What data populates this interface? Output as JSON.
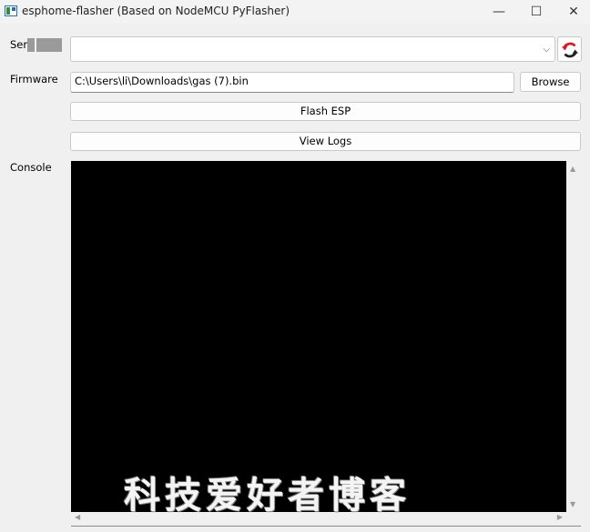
{
  "window": {
    "title": "esphome-flasher (Based on NodeMCU PyFlasher)",
    "minimize": "—",
    "maximize": "☐",
    "close": "✕"
  },
  "form": {
    "serial_label": "Ser",
    "serial_value": "",
    "firmware_label": "Firmware",
    "firmware_value": "C:\\Users\\li\\Downloads\\gas (7).bin",
    "browse_label": "Browse",
    "flash_label": "Flash ESP",
    "view_logs_label": "View Logs",
    "console_label": "Console"
  },
  "icons": {
    "combo_chevron": "⌵",
    "scroll_up": "▲",
    "scroll_down": "▼",
    "scroll_left": "◀",
    "scroll_right": "▶",
    "refresh": "refresh-icon"
  },
  "colors": {
    "console_bg": "#000000",
    "refresh_icon": "#d11f2a"
  },
  "watermark": "科技爱好者博客"
}
